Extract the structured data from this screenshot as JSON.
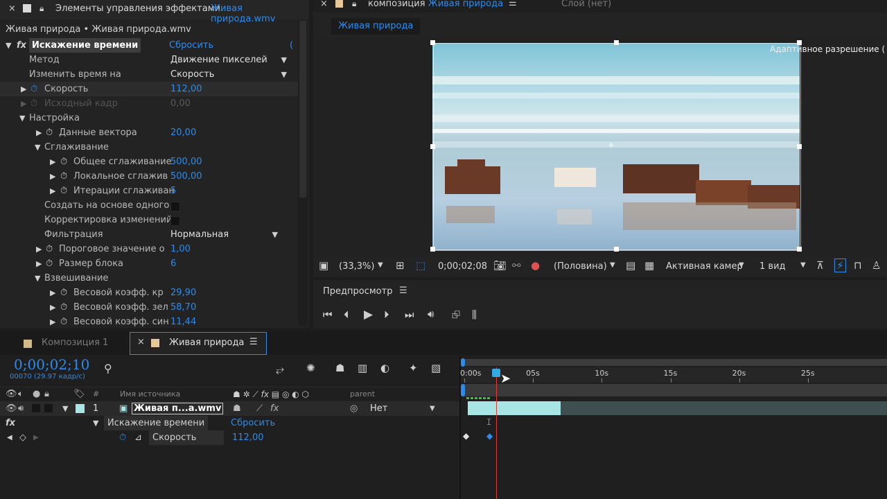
{
  "effects_panel": {
    "tab_label": "Элементы управления эффектами",
    "tab_file": "Живая природа.wmv",
    "breadcrumb": "Живая природа • Живая природа.wmv",
    "effect_name": "Искажение времени",
    "reset": "Сбросить",
    "reset_tail": "(",
    "rows": {
      "method_label": "Метод",
      "method_value": "Движение пикселей",
      "remap_label": "Изменить время на",
      "remap_value": "Скорость",
      "speed_label": "Скорость",
      "speed_value": "112,00",
      "source_label": "Исходный кадр",
      "source_value": "0,00",
      "settings_label": "Настройка",
      "vector_label": "Данные вектора",
      "vector_value": "20,00",
      "smoothing_label": "Сглаживание",
      "global_label": "Общее сглаживание",
      "global_value": "500,00",
      "local_label": "Локальное сглажив",
      "local_value": "500,00",
      "iter_label": "Итерации сглаживан",
      "iter_value": "5",
      "build_label": "Создать на основе одного",
      "correct_label": "Корректировка изменений",
      "filter_label": "Фильтрация",
      "filter_value": "Нормальная",
      "threshold_label": "Пороговое значение о",
      "threshold_value": "1,00",
      "block_label": "Размер блока",
      "block_value": "6",
      "weight_label": "Взвешивание",
      "red_label": "Весовой коэфф. кр",
      "red_value": "29,90",
      "green_label": "Весовой коэфф. зел",
      "green_value": "58,70",
      "blue_label": "Весовой коэфф. син",
      "blue_value": "11,44"
    }
  },
  "comp_panel": {
    "tab_label": "композиция",
    "tab_name": "Живая природа",
    "layer_tab": "Слой (нет)",
    "comp_button": "Живая природа",
    "overlay_text": "Адаптивное разрешение (",
    "toolbar": {
      "zoom": "(33,3%)",
      "timecode": "0;00;02;08",
      "resolution": "(Половина)",
      "camera": "Активная камер",
      "views": "1 вид"
    }
  },
  "preview_panel": {
    "title": "Предпросмотр"
  },
  "timeline": {
    "tab_inactive": "Композиция 1",
    "tab_active": "Живая природа",
    "timecode": "0;00;02;10",
    "frame_info": "00070 (29.97 кадр/с)",
    "col_source": "Имя источника",
    "col_num": "#",
    "col_parent": "parent",
    "layer_number": "1",
    "layer_name": "Живая п...a.wmv",
    "parent_value": "Нет",
    "effect_name": "Искажение времени",
    "effect_reset": "Сбросить",
    "speed_label": "Скорость",
    "speed_value": "112,00",
    "fx_label": "fx",
    "ruler": [
      "0:00s",
      "05s",
      "10s",
      "15s",
      "20s",
      "25s"
    ],
    "playhead_seconds": 2.33,
    "duration_seconds": 30
  },
  "colors": {
    "accent": "#2d8ceb",
    "layer_label": "#a8e6e6",
    "playhead": "#e53935",
    "work_area": "#33a9e6"
  }
}
